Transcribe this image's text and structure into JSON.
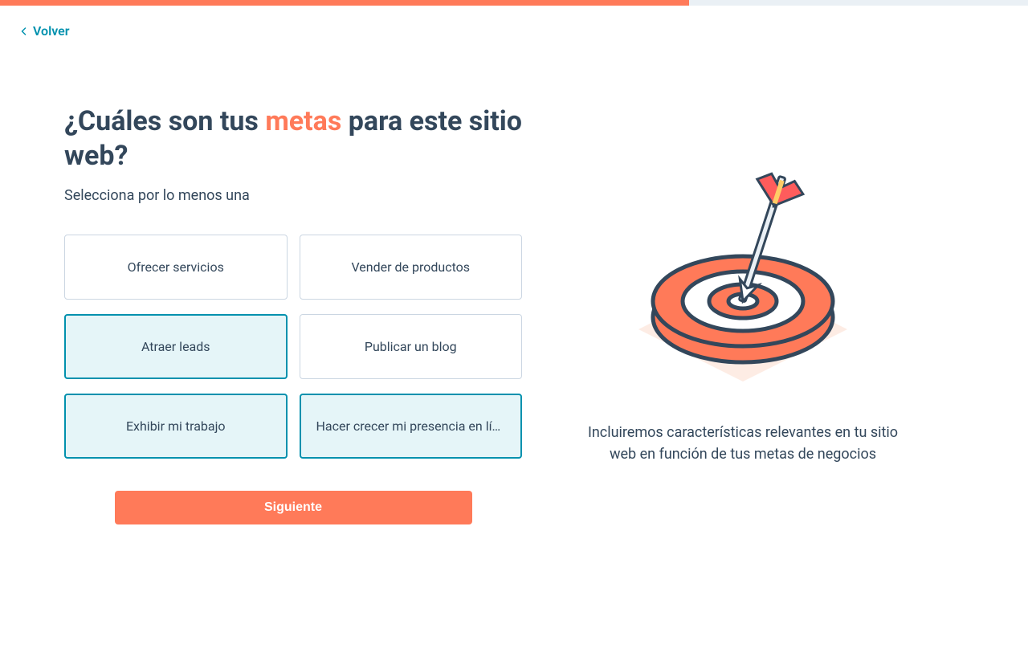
{
  "nav": {
    "back_label": "Volver"
  },
  "heading": {
    "prefix": "¿Cuáles son tus ",
    "highlight": "metas",
    "suffix": " para este sitio web?"
  },
  "subtitle": "Selecciona por lo menos una",
  "options": [
    {
      "label": "Ofrecer servicios",
      "selected": false
    },
    {
      "label": "Vender de productos",
      "selected": false
    },
    {
      "label": "Atraer leads",
      "selected": true
    },
    {
      "label": "Publicar un blog",
      "selected": false
    },
    {
      "label": "Exhibir mi trabajo",
      "selected": true
    },
    {
      "label": "Hacer crecer mi presencia en línea",
      "selected": true
    }
  ],
  "next_button": "Siguiente",
  "description": "Incluiremos características relevantes en tu sitio web en función de tus metas de negocios",
  "progress": {
    "percent": 67
  },
  "colors": {
    "accent": "#ff7a59",
    "link": "#0091ae",
    "text": "#33475b",
    "selected_bg": "#e5f5f8"
  }
}
